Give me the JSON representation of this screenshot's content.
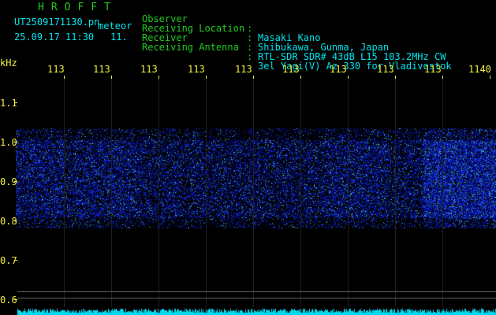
{
  "header": {
    "app_title": "HROFFT",
    "filename": "UT2509171130.pn",
    "file_type": "meteor",
    "datetime": "25.09.17 11:30",
    "count": "11."
  },
  "station": {
    "rows": [
      {
        "label": "Observer",
        "value": "Masaki Kano"
      },
      {
        "label": "Receiving Location",
        "value": "Shibukawa, Gunma, Japan"
      },
      {
        "label": "Receiver",
        "value": "RTL-SDR SDR# 43dB L15 103.2MHz CW"
      },
      {
        "label": "Receiving Antenna",
        "value": "3el Yagi(V) Az 330 for Vladivostok"
      }
    ]
  },
  "axes": {
    "y_unit": "kHz",
    "y_ticks": [
      "1.1",
      "1.0",
      "0.9",
      "0.8",
      "0.7",
      "0.6"
    ],
    "x_ticks": [
      "113",
      "113",
      "113",
      "113",
      "113",
      "113",
      "113",
      "113",
      "113",
      "1140"
    ]
  },
  "colors": {
    "label": "#22cc22",
    "value": "#00e5ee",
    "axis": "#f0f040",
    "noise": "#2040ff",
    "background": "#000000"
  }
}
